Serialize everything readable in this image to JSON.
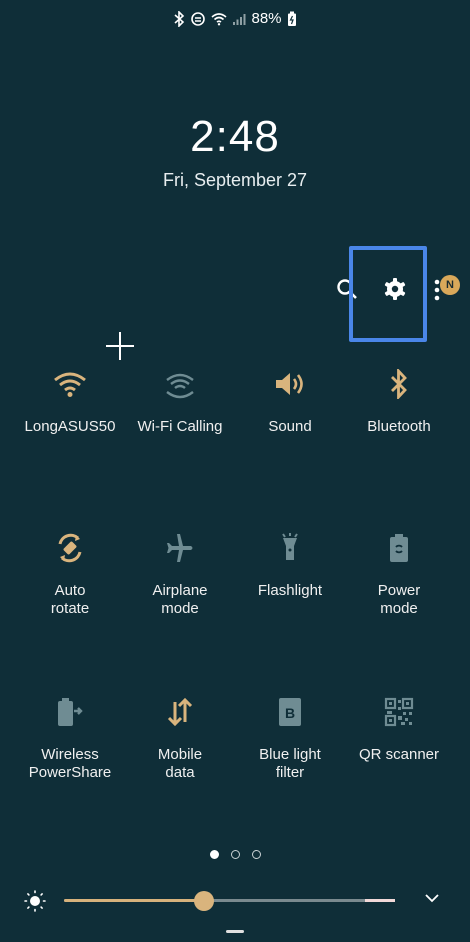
{
  "status_bar": {
    "battery": "88%",
    "icons": [
      "bluetooth-icon",
      "data-saver-icon",
      "wifi-icon",
      "signal-icon",
      "battery-icon"
    ]
  },
  "clock": {
    "time": "2:48",
    "date": "Fri, September 27"
  },
  "top_actions": {
    "icons": [
      "search-icon",
      "settings-gear-icon",
      "more-options-icon"
    ],
    "notification_badge": "N"
  },
  "tiles": [
    {
      "label": "LongASUS50",
      "icon": "wifi-icon",
      "active": true
    },
    {
      "label": "Wi-Fi Calling",
      "icon": "wifi-calling-icon",
      "active": false
    },
    {
      "label": "Sound",
      "icon": "sound-icon",
      "active": true
    },
    {
      "label": "Bluetooth",
      "icon": "bluetooth-icon",
      "active": true
    },
    {
      "label": "Auto\nrotate",
      "icon": "auto-rotate-icon",
      "active": true
    },
    {
      "label": "Airplane\nmode",
      "icon": "airplane-icon",
      "active": false
    },
    {
      "label": "Flashlight",
      "icon": "flashlight-icon",
      "active": false
    },
    {
      "label": "Power\nmode",
      "icon": "power-mode-icon",
      "active": false
    },
    {
      "label": "Wireless\nPowerShare",
      "icon": "wireless-powershare-icon",
      "active": false
    },
    {
      "label": "Mobile\ndata",
      "icon": "mobile-data-icon",
      "active": true
    },
    {
      "label": "Blue light\nfilter",
      "icon": "blue-light-filter-icon",
      "active": false
    },
    {
      "label": "QR scanner",
      "icon": "qr-scanner-icon",
      "active": false
    }
  ],
  "pagination": {
    "pages": 3,
    "current": 1
  },
  "brightness": {
    "level": 0.43
  },
  "colors": {
    "background": "#0f2e38",
    "accent": "#d9b47d",
    "highlight": "#4a86e8",
    "inactive_icon": "#6f8c93"
  }
}
